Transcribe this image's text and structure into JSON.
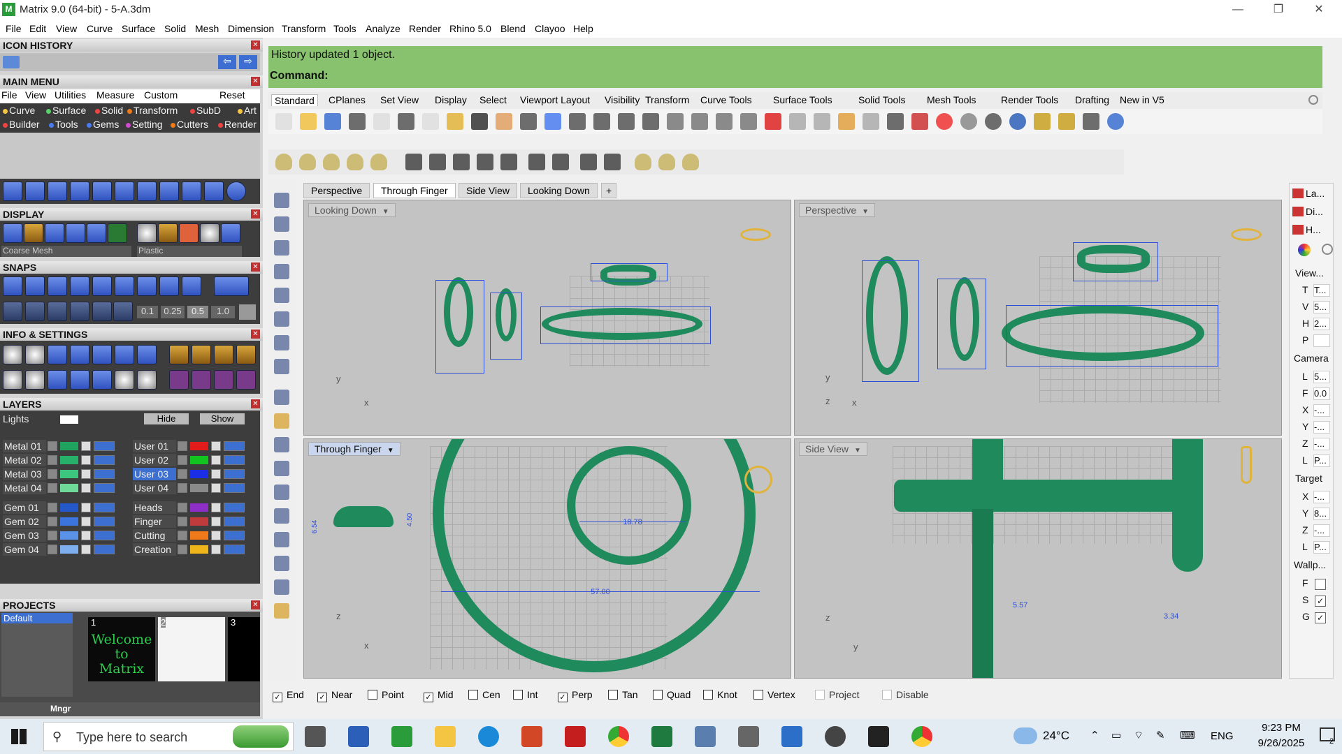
{
  "window": {
    "title": "Matrix 9.0 (64-bit) - 5-A.3dm",
    "minimize": "—",
    "restore": "❐",
    "close": "✕"
  },
  "menu": [
    "File",
    "Edit",
    "View",
    "Curve",
    "Surface",
    "Solid",
    "Mesh",
    "Dimension",
    "Transform",
    "Tools",
    "Analyze",
    "Render",
    "Rhino 5.0",
    "Blend",
    "Clayoo",
    "Help"
  ],
  "left": {
    "icon_history": "ICON HISTORY",
    "main_menu": "MAIN MENU",
    "main_menu_items": [
      "File",
      "View",
      "Utilities",
      "Measure",
      "Custom",
      "Reset"
    ],
    "main_menu_row2": [
      "Curve",
      "Surface",
      "Solid",
      "Transform",
      "SubD",
      "Art"
    ],
    "main_menu_row3": [
      "Builder",
      "Tools",
      "Gems",
      "Setting",
      "Cutters",
      "Render"
    ],
    "display": "DISPLAY",
    "display_mesh": "Coarse Mesh",
    "display_material": "Plastic",
    "snaps": "SNAPS",
    "snap_values": [
      "0.1",
      "0.25",
      "0.5",
      "1.0"
    ],
    "info": "INFO & SETTINGS",
    "layers": "LAYERS",
    "lights": "Lights",
    "hide": "Hide",
    "show": "Show",
    "layer_left": [
      {
        "name": "Metal 01",
        "color": "#1fa35e"
      },
      {
        "name": "Metal 02",
        "color": "#27b06a"
      },
      {
        "name": "Metal 03",
        "color": "#3dc77e"
      },
      {
        "name": "Metal 04",
        "color": "#6fd99a"
      },
      {
        "name": "Gem 01",
        "color": "#2458c8"
      },
      {
        "name": "Gem 02",
        "color": "#3a74dc"
      },
      {
        "name": "Gem 03",
        "color": "#5a92e8"
      },
      {
        "name": "Gem 04",
        "color": "#7eaeee"
      }
    ],
    "layer_right": [
      {
        "name": "User 01",
        "color": "#e21b1b"
      },
      {
        "name": "User 02",
        "color": "#12c41f"
      },
      {
        "name": "User 03",
        "color": "#1a2ee6"
      },
      {
        "name": "User 04",
        "color": "#8a8a8a"
      },
      {
        "name": "Heads",
        "color": "#8d2fc6"
      },
      {
        "name": "Finger",
        "color": "#c03b3b"
      },
      {
        "name": "Cutting",
        "color": "#f07a1a"
      },
      {
        "name": "Creation",
        "color": "#f0b51a"
      }
    ],
    "projects": "PROJECTS",
    "project_default": "Default",
    "project_nums": [
      "1",
      "2",
      "3"
    ],
    "welcome": "Welcome to Matrix",
    "mngr": "Mngr"
  },
  "command": {
    "history": "History updated 1 object.",
    "prompt": "Command:"
  },
  "toolbar_tabs": [
    "Standard",
    "CPlanes",
    "Set View",
    "Display",
    "Select",
    "Viewport Layout",
    "Visibility",
    "Transform",
    "Curve Tools",
    "Surface Tools",
    "Solid Tools",
    "Mesh Tools",
    "Render Tools",
    "Drafting",
    "New in V5"
  ],
  "viewport_tabs": [
    "Perspective",
    "Through Finger",
    "Side View",
    "Looking Down"
  ],
  "viewports": {
    "top_left": "Looking Down",
    "top_right": "Perspective",
    "bottom_left": "Through Finger",
    "bottom_right": "Side View"
  },
  "dims": {
    "d1": "6.54",
    "d2": "4.50",
    "d3": "18.78",
    "d4": "57.00",
    "d5": "5.57",
    "d6": "3.34"
  },
  "axes": {
    "x": "x",
    "y": "y",
    "z": "z"
  },
  "right": {
    "tabs": [
      "La...",
      "Di...",
      "H..."
    ],
    "view": "View...",
    "view_rows": [
      [
        "T",
        "T..."
      ],
      [
        "V",
        "5..."
      ],
      [
        "H",
        "2..."
      ],
      [
        "P",
        ""
      ]
    ],
    "camera": "Camera",
    "camera_rows": [
      [
        "L",
        "5..."
      ],
      [
        "F",
        "0.0"
      ],
      [
        "X",
        "-..."
      ],
      [
        "Y",
        "-..."
      ],
      [
        "Z",
        "-..."
      ],
      [
        "L",
        "P..."
      ]
    ],
    "target": "Target",
    "target_rows": [
      [
        "X",
        "-..."
      ],
      [
        "Y",
        "8..."
      ],
      [
        "Z",
        "-..."
      ],
      [
        "L",
        "P..."
      ]
    ],
    "wallp": "Wallp...",
    "wallp_rows": [
      "F",
      "S",
      "G"
    ]
  },
  "osnaps": [
    {
      "label": "End",
      "checked": true
    },
    {
      "label": "Near",
      "checked": true
    },
    {
      "label": "Point",
      "checked": false
    },
    {
      "label": "Mid",
      "checked": true
    },
    {
      "label": "Cen",
      "checked": false
    },
    {
      "label": "Int",
      "checked": false
    },
    {
      "label": "Perp",
      "checked": true
    },
    {
      "label": "Tan",
      "checked": false
    },
    {
      "label": "Quad",
      "checked": false
    },
    {
      "label": "Knot",
      "checked": false
    },
    {
      "label": "Vertex",
      "checked": false
    },
    {
      "label": "Project",
      "checked": false
    },
    {
      "label": "Disable",
      "checked": false
    }
  ],
  "taskbar": {
    "search": "Type here to search",
    "temp": "24°C",
    "lang": "ENG",
    "time": "9:23 PM",
    "date": "9/26/2025",
    "notif": "2"
  }
}
